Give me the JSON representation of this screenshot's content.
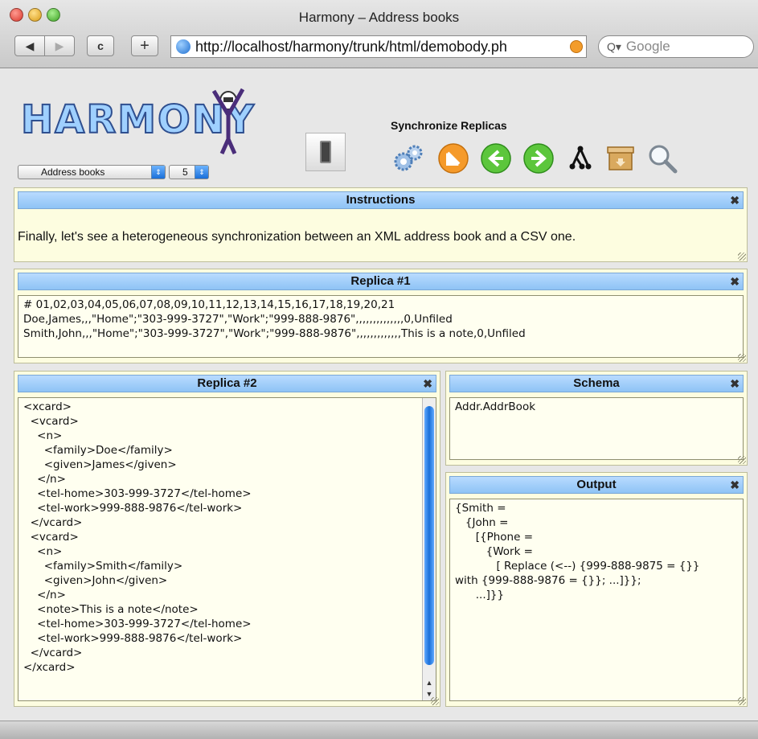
{
  "window": {
    "title": "Harmony – Address books"
  },
  "browser": {
    "url": "http://localhost/harmony/trunk/html/demobody.ph",
    "search_placeholder": "Google",
    "back_glyph": "◀",
    "forward_glyph": "▶",
    "reload_glyph": "c",
    "add_glyph": "+"
  },
  "app": {
    "logo_text": "HARMONY",
    "demo_select": "Address books",
    "step_select": "5",
    "toolbar_title": "Synchronize Replicas"
  },
  "panels": {
    "instructions": {
      "title": "Instructions",
      "text": "Finally, let's see a heterogeneous synchronization between an XML address book and a CSV one."
    },
    "replica1": {
      "title": "Replica #1",
      "content": "# 01,02,03,04,05,06,07,08,09,10,11,12,13,14,15,16,17,18,19,20,21\nDoe,James,,,\"Home\";\"303-999-3727\",\"Work\";\"999-888-9876\",,,,,,,,,,,,,,0,Unfiled\nSmith,John,,,\"Home\";\"303-999-3727\",\"Work\";\"999-888-9876\",,,,,,,,,,,,,This is a note,0,Unfiled"
    },
    "replica2": {
      "title": "Replica #2",
      "content": "<xcard>\n  <vcard>\n    <n>\n      <family>Doe</family>\n      <given>James</given>\n    </n>\n    <tel-home>303-999-3727</tel-home>\n    <tel-work>999-888-9876</tel-work>\n  </vcard>\n  <vcard>\n    <n>\n      <family>Smith</family>\n      <given>John</given>\n    </n>\n    <note>This is a note</note>\n    <tel-home>303-999-3727</tel-home>\n    <tel-work>999-888-9876</tel-work>\n  </vcard>\n</xcard>"
    },
    "schema": {
      "title": "Schema",
      "content": "Addr.AddrBook"
    },
    "output": {
      "title": "Output",
      "content": "{Smith =\n   {John =\n      [{Phone =\n         {Work =\n            [ Replace (<--) {999-888-9875 = {}}\nwith {999-888-9876 = {}}; ...]}};\n      ...]}}"
    }
  },
  "close_glyph": "✖",
  "icons": [
    "gears-icon",
    "orange-circle-icon",
    "left-arrow-icon",
    "right-arrow-icon",
    "tree-icon",
    "archive-box-icon",
    "magnifier-icon"
  ]
}
